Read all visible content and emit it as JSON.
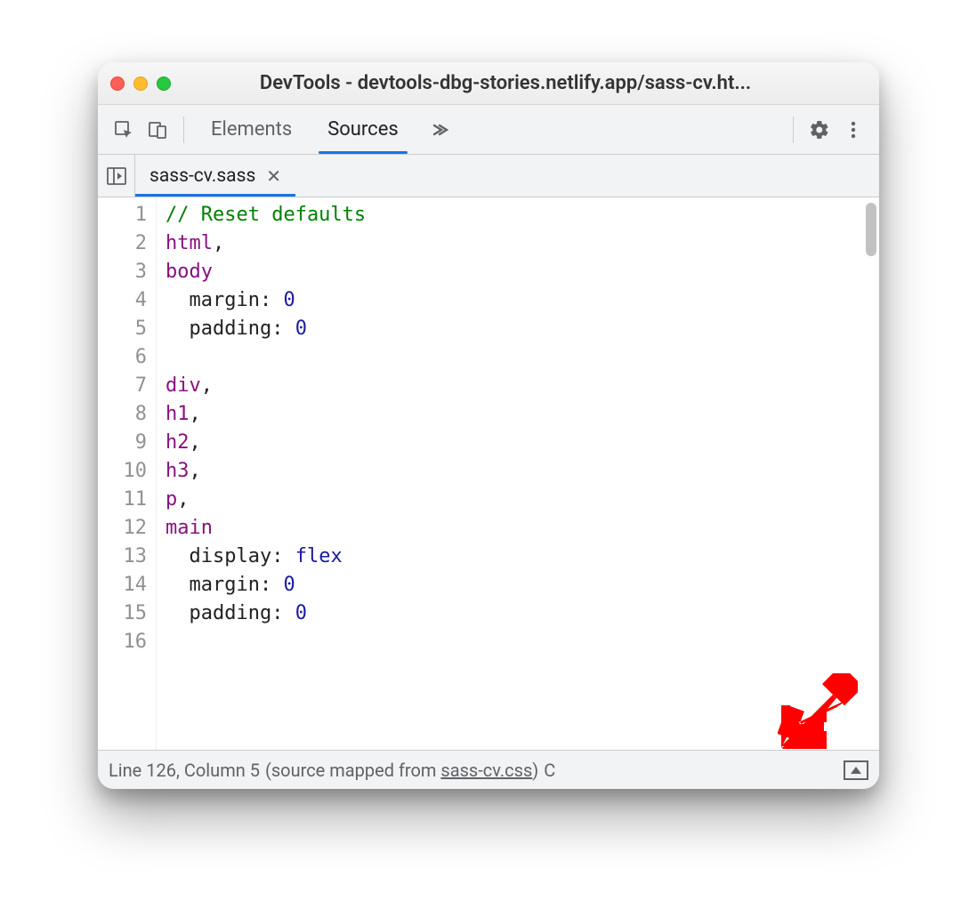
{
  "window": {
    "title": "DevTools - devtools-dbg-stories.netlify.app/sass-cv.ht..."
  },
  "toolbar": {
    "tabs": [
      {
        "label": "Elements",
        "active": false
      },
      {
        "label": "Sources",
        "active": true
      }
    ]
  },
  "filetab": {
    "name": "sass-cv.sass"
  },
  "code_lines": [
    [
      {
        "cls": "tok-comment",
        "text": "// Reset defaults"
      }
    ],
    [
      {
        "cls": "tok-tag",
        "text": "html"
      },
      {
        "cls": "tok-punc",
        "text": ","
      }
    ],
    [
      {
        "cls": "tok-tag",
        "text": "body"
      }
    ],
    [
      {
        "cls": "",
        "text": "  "
      },
      {
        "cls": "tok-prop",
        "text": "margin"
      },
      {
        "cls": "tok-punc",
        "text": ": "
      },
      {
        "cls": "tok-val",
        "text": "0"
      }
    ],
    [
      {
        "cls": "",
        "text": "  "
      },
      {
        "cls": "tok-prop",
        "text": "padding"
      },
      {
        "cls": "tok-punc",
        "text": ": "
      },
      {
        "cls": "tok-val",
        "text": "0"
      }
    ],
    [],
    [
      {
        "cls": "tok-tag",
        "text": "div"
      },
      {
        "cls": "tok-punc",
        "text": ","
      }
    ],
    [
      {
        "cls": "tok-tag",
        "text": "h1"
      },
      {
        "cls": "tok-punc",
        "text": ","
      }
    ],
    [
      {
        "cls": "tok-tag",
        "text": "h2"
      },
      {
        "cls": "tok-punc",
        "text": ","
      }
    ],
    [
      {
        "cls": "tok-tag",
        "text": "h3"
      },
      {
        "cls": "tok-punc",
        "text": ","
      }
    ],
    [
      {
        "cls": "tok-tag",
        "text": "p"
      },
      {
        "cls": "tok-punc",
        "text": ","
      }
    ],
    [
      {
        "cls": "tok-tag",
        "text": "main"
      }
    ],
    [
      {
        "cls": "",
        "text": "  "
      },
      {
        "cls": "tok-prop",
        "text": "display"
      },
      {
        "cls": "tok-punc",
        "text": ": "
      },
      {
        "cls": "tok-val",
        "text": "flex"
      }
    ],
    [
      {
        "cls": "",
        "text": "  "
      },
      {
        "cls": "tok-prop",
        "text": "margin"
      },
      {
        "cls": "tok-punc",
        "text": ": "
      },
      {
        "cls": "tok-val",
        "text": "0"
      }
    ],
    [
      {
        "cls": "",
        "text": "  "
      },
      {
        "cls": "tok-prop",
        "text": "padding"
      },
      {
        "cls": "tok-punc",
        "text": ": "
      },
      {
        "cls": "tok-val",
        "text": "0"
      }
    ],
    []
  ],
  "status": {
    "line": "126",
    "column": "5",
    "mapped_prefix": "(source mapped from ",
    "mapped_file": "sass-cv.css",
    "mapped_suffix": ")",
    "coverage_prefix": "C"
  }
}
